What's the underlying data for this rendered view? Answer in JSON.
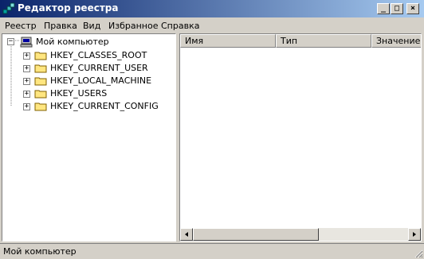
{
  "window": {
    "title": "Редактор реестра",
    "controls": {
      "minimize": "_",
      "maximize": "□",
      "close": "×"
    }
  },
  "menu": [
    "Реестр",
    "Правка",
    "Вид",
    "Избранное",
    "Справка"
  ],
  "tree": {
    "root": {
      "label": "Мой компьютер",
      "expander": "−",
      "icon": "computer-icon"
    },
    "keys": [
      {
        "label": "HKEY_CLASSES_ROOT",
        "expander": "+"
      },
      {
        "label": "HKEY_CURRENT_USER",
        "expander": "+"
      },
      {
        "label": "HKEY_LOCAL_MACHINE",
        "expander": "+"
      },
      {
        "label": "HKEY_USERS",
        "expander": "+"
      },
      {
        "label": "HKEY_CURRENT_CONFIG",
        "expander": "+"
      }
    ]
  },
  "list": {
    "columns": [
      "Имя",
      "Тип",
      "Значение"
    ]
  },
  "status": {
    "text": "Мой компьютер"
  },
  "colors": {
    "title_start": "#0a246a",
    "title_end": "#a6caf0",
    "folder": "#ffe680"
  }
}
